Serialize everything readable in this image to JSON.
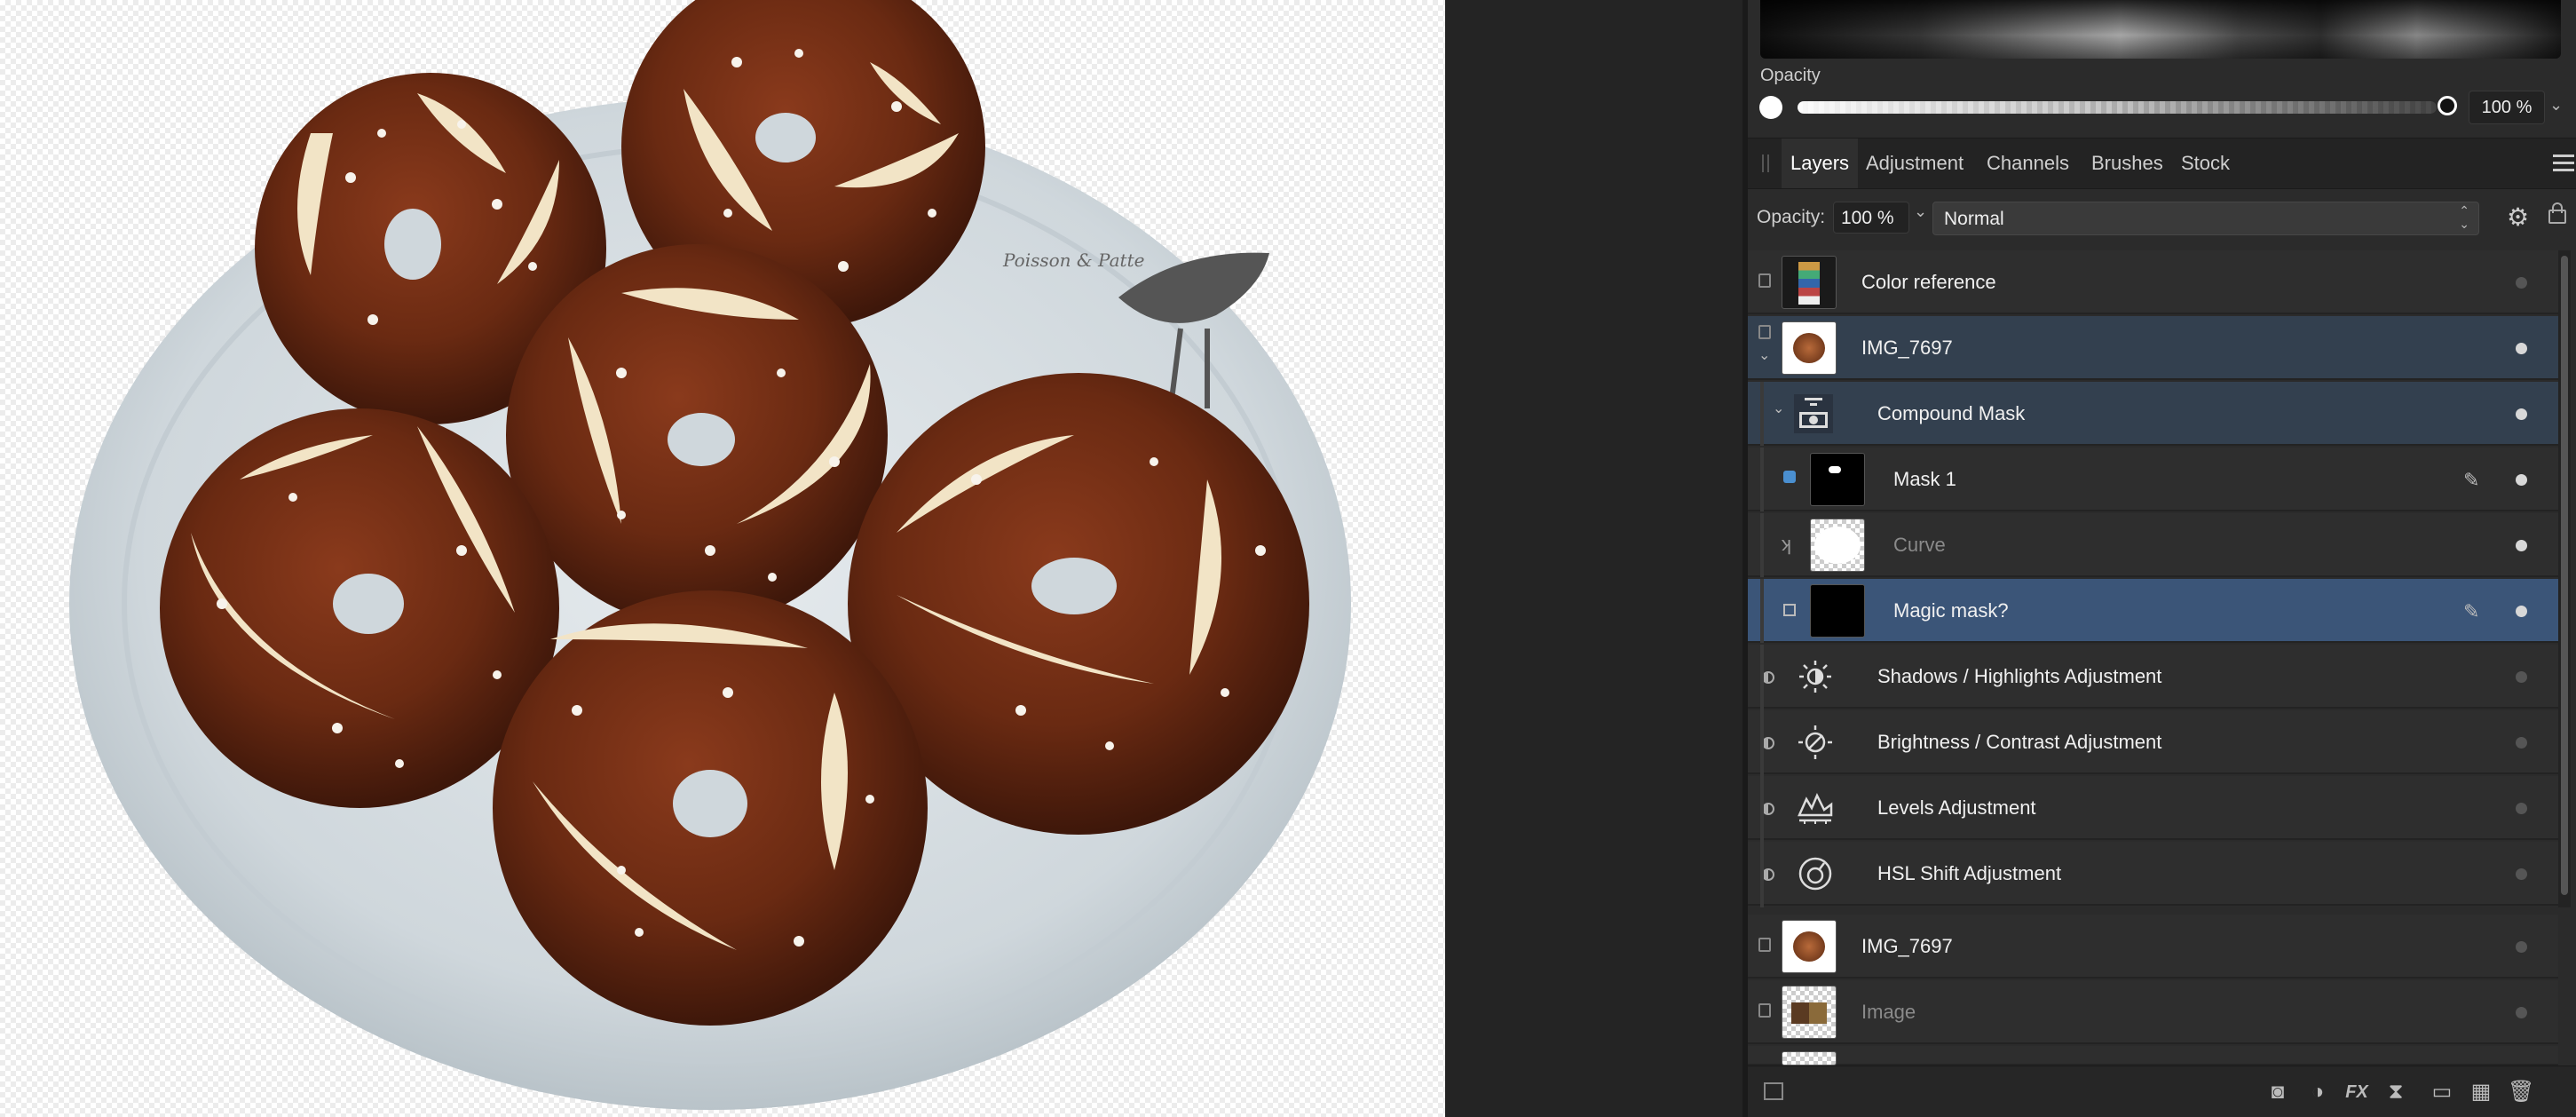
{
  "canvas": {
    "plate_brand_text": "Poisson & Patte"
  },
  "colors": {
    "panel_bg": "#2b2b2b",
    "selected_row": "#33404f",
    "selected_row_active": "#3b5578",
    "accent": "#4a90d9"
  },
  "top_panel": {
    "opacity_label": "Opacity",
    "opacity_value": "100 %"
  },
  "tabs": [
    "Layers",
    "Adjustment",
    "Channels",
    "Brushes",
    "Stock"
  ],
  "layer_controls": {
    "opacity_label": "Opacity:",
    "opacity_value": "100 %",
    "blend_mode": "Normal"
  },
  "layers": [
    {
      "name": "Color reference",
      "icon": "pixel-layer-icon"
    },
    {
      "name": "IMG_7697",
      "icon": "pixel-layer-icon",
      "expanded": true
    },
    {
      "name": "Compound Mask",
      "icon": "compound-mask-icon",
      "expanded": true
    },
    {
      "name": "Mask 1",
      "icon": "mask-icon"
    },
    {
      "name": "Curve",
      "icon": "curve-icon"
    },
    {
      "name": "Magic mask?",
      "icon": "mask-icon"
    },
    {
      "name": "Shadows / Highlights Adjustment",
      "icon": "shadows-highlights-icon"
    },
    {
      "name": "Brightness / Contrast Adjustment",
      "icon": "brightness-contrast-icon"
    },
    {
      "name": "Levels Adjustment",
      "icon": "levels-icon"
    },
    {
      "name": "HSL Shift Adjustment",
      "icon": "hsl-icon"
    },
    {
      "name": "IMG_7697",
      "icon": "pixel-layer-icon"
    },
    {
      "name": "Image",
      "icon": "pixel-layer-icon"
    }
  ],
  "bottom_toolbar": {
    "icons": [
      "mask-layer-icon",
      "adjustment-icon",
      "fx-icon",
      "live-filter-icon",
      "group-icon",
      "add-pixel-layer-icon",
      "delete-icon"
    ],
    "fx_label": "FX"
  }
}
